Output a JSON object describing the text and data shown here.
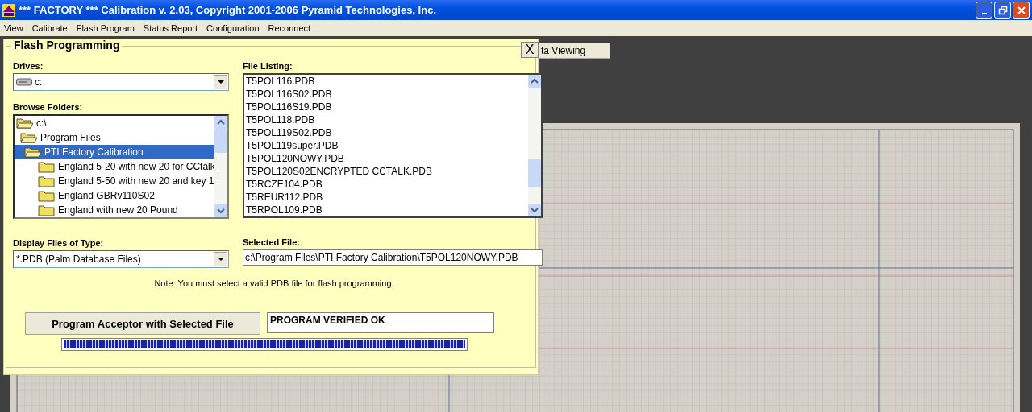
{
  "window": {
    "title": "*** FACTORY *** Calibration v. 2.03, Copyright 2001-2006  Pyramid Technologies, Inc."
  },
  "menu": [
    "View",
    "Calibrate",
    "Flash Program",
    "Status Report",
    "Configuration",
    "Reconnect"
  ],
  "background_button": {
    "label": "ta Viewing"
  },
  "dialog": {
    "title": "Flash Programming",
    "close": "X",
    "drives": {
      "label": "Drives:",
      "value": "c:"
    },
    "folders": {
      "label": "Browse Folders:",
      "tree": [
        {
          "name": "c:\\",
          "expanded": true,
          "selected": false,
          "children": [
            {
              "name": "Program Files",
              "expanded": true,
              "selected": false,
              "children": [
                {
                  "name": "PTI Factory Calibration",
                  "expanded": true,
                  "selected": true,
                  "children": [
                    {
                      "name": "England 5-20 with new 20 for CCtalk",
                      "expanded": false,
                      "selected": false
                    },
                    {
                      "name": "England 5-50 with new 20 and key 1",
                      "expanded": false,
                      "selected": false
                    },
                    {
                      "name": "England GBRv110S02",
                      "expanded": false,
                      "selected": false
                    },
                    {
                      "name": "England with new 20 Pound",
                      "expanded": false,
                      "selected": false
                    }
                  ]
                }
              ]
            }
          ]
        }
      ]
    },
    "files": {
      "label": "File Listing:",
      "items": [
        "T5POL116.PDB",
        "T5POL116S02.PDB",
        "T5POL116S19.PDB",
        "T5POL118.PDB",
        "T5POL119S02.PDB",
        "T5POL119super.PDB",
        "T5POL120NOWY.PDB",
        "T5POL120S02ENCRYPTED CCTALK.PDB",
        "T5RCZE104.PDB",
        "T5REUR112.PDB",
        "T5RPOL109.PDB"
      ]
    },
    "file_type": {
      "label": "Display Files of Type:",
      "value": "*.PDB (Palm Database Files)"
    },
    "selected_file": {
      "label": "Selected File:",
      "value": "c:\\Program Files\\PTI Factory Calibration\\T5POL120NOWY.PDB"
    },
    "note": "Note: You must select a valid PDB file for flash programming.",
    "program_button": "Program Acceptor with Selected File",
    "status": "PROGRAM VERIFIED OK",
    "progress": {
      "level": 1.0
    }
  }
}
